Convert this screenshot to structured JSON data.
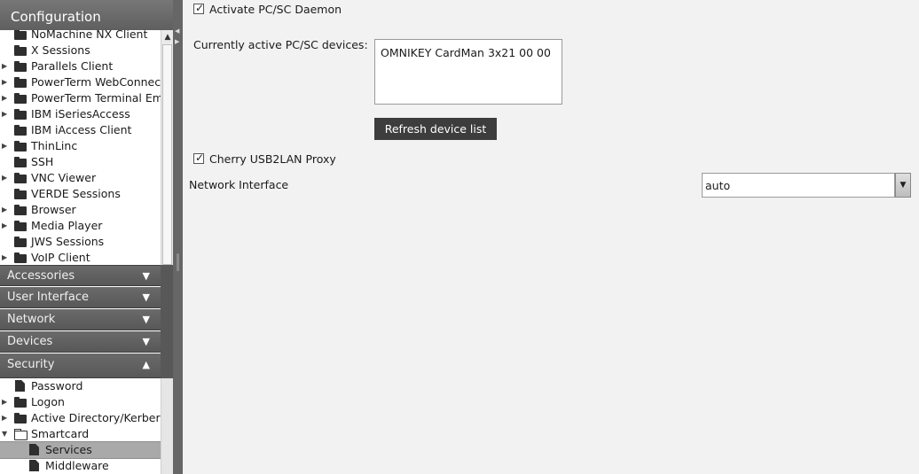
{
  "sidebar": {
    "title": "Configuration",
    "top_items": [
      {
        "label": "NoMachine NX Client",
        "expandable": false,
        "icon": "folder-icon"
      },
      {
        "label": "X Sessions",
        "expandable": false,
        "icon": "folder-icon"
      },
      {
        "label": "Parallels Client",
        "expandable": true,
        "icon": "folder-icon"
      },
      {
        "label": "PowerTerm WebConnect",
        "expandable": true,
        "icon": "folder-icon"
      },
      {
        "label": "PowerTerm Terminal Emulation",
        "expandable": true,
        "icon": "folder-icon"
      },
      {
        "label": "IBM iSeriesAccess",
        "expandable": true,
        "icon": "folder-icon"
      },
      {
        "label": "IBM iAccess Client",
        "expandable": false,
        "icon": "folder-icon"
      },
      {
        "label": "ThinLinc",
        "expandable": true,
        "icon": "folder-icon"
      },
      {
        "label": "SSH",
        "expandable": false,
        "icon": "folder-icon"
      },
      {
        "label": "VNC Viewer",
        "expandable": true,
        "icon": "folder-icon"
      },
      {
        "label": "VERDE Sessions",
        "expandable": false,
        "icon": "folder-icon"
      },
      {
        "label": "Browser",
        "expandable": true,
        "icon": "folder-icon"
      },
      {
        "label": "Media Player",
        "expandable": true,
        "icon": "folder-icon"
      },
      {
        "label": "JWS Sessions",
        "expandable": false,
        "icon": "folder-icon"
      },
      {
        "label": "VoIP Client",
        "expandable": true,
        "icon": "folder-icon"
      }
    ],
    "sections": [
      {
        "label": "Accessories",
        "state": "collapsed"
      },
      {
        "label": "User Interface",
        "state": "collapsed"
      },
      {
        "label": "Network",
        "state": "collapsed"
      },
      {
        "label": "Devices",
        "state": "collapsed"
      },
      {
        "label": "Security",
        "state": "expanded"
      }
    ],
    "security_items": [
      {
        "label": "Password"
      },
      {
        "label": "Logon"
      },
      {
        "label": "Active Directory/Kerberos"
      },
      {
        "label": "Smartcard"
      },
      {
        "label": "Services"
      },
      {
        "label": "Middleware"
      }
    ]
  },
  "main": {
    "activate_pcsc": {
      "label": "Activate PC/SC Daemon",
      "checked": true
    },
    "devices_label": "Currently active PC/SC devices:",
    "devices": [
      "OMNIKEY CardMan 3x21 00 00"
    ],
    "refresh_button": "Refresh device list",
    "cherry_proxy": {
      "label": "Cherry USB2LAN Proxy",
      "checked": true
    },
    "network_interface": {
      "label": "Network Interface",
      "value": "auto"
    }
  },
  "icons": {
    "check": "✓",
    "expand": "▶",
    "collapse": "▼",
    "section_collapsed": "▼",
    "section_expanded": "▲",
    "dropdown": "▼"
  }
}
